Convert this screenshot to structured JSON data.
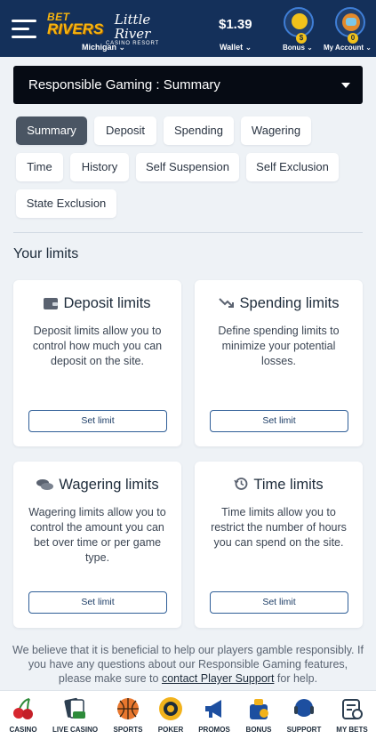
{
  "header": {
    "brand_bet": "BET",
    "brand_rivers": "RIVERS",
    "brand_little_river": "Little River",
    "brand_casino_resort": "CASINO RESORT",
    "state": "Michigan ⌄",
    "balance": "$1.39",
    "wallet_label": "Wallet ⌄",
    "bonus_count": "$",
    "bonus_label": "Bonus ⌄",
    "account_count": "0",
    "account_label": "My Account ⌄"
  },
  "section_select": {
    "value": "Responsible Gaming : Summary"
  },
  "tabs": [
    {
      "label": "Summary",
      "active": true
    },
    {
      "label": "Deposit"
    },
    {
      "label": "Spending"
    },
    {
      "label": "Wagering"
    },
    {
      "label": "Time"
    },
    {
      "label": "History"
    },
    {
      "label": "Self Suspension"
    },
    {
      "label": "Self Exclusion"
    },
    {
      "label": "State Exclusion"
    }
  ],
  "limits_title": "Your limits",
  "cards": [
    {
      "title": "Deposit limits",
      "icon": "wallet-icon",
      "description": "Deposit limits allow you to control how much you can deposit on the site.",
      "button": "Set limit"
    },
    {
      "title": "Spending limits",
      "icon": "trend-down-icon",
      "description": "Define spending limits to minimize your potential losses.",
      "button": "Set limit"
    },
    {
      "title": "Wagering limits",
      "icon": "coins-icon",
      "description": "Wagering limits allow you to control the amount you can bet over time or per game type.",
      "button": "Set limit"
    },
    {
      "title": "Time limits",
      "icon": "history-clock-icon",
      "description": "Time limits allow you to restrict the number of hours you can spend on the site.",
      "button": "Set limit"
    }
  ],
  "footnote": {
    "text_before": "We believe that it is beneficial to help our players gamble responsibly. If you have any questions about our Responsible Gaming features, please make sure to ",
    "link": "contact Player Support",
    "text_after": " for help."
  },
  "bottom_nav": [
    {
      "label": "CASINO",
      "icon": "cherries-icon"
    },
    {
      "label": "LIVE CASINO",
      "icon": "live-cards-icon"
    },
    {
      "label": "SPORTS",
      "icon": "basketball-icon"
    },
    {
      "label": "POKER",
      "icon": "poker-chip-icon"
    },
    {
      "label": "PROMOS",
      "icon": "megaphone-icon"
    },
    {
      "label": "BONUS",
      "icon": "bonus-bag-icon"
    },
    {
      "label": "SUPPORT",
      "icon": "headset-icon"
    },
    {
      "label": "MY BETS",
      "icon": "bet-slip-icon"
    }
  ],
  "colors": {
    "header_bg": "#14305a",
    "accent_gold": "#f6b40f",
    "active_tab": "#4a5563",
    "button_border": "#2f5e97"
  }
}
